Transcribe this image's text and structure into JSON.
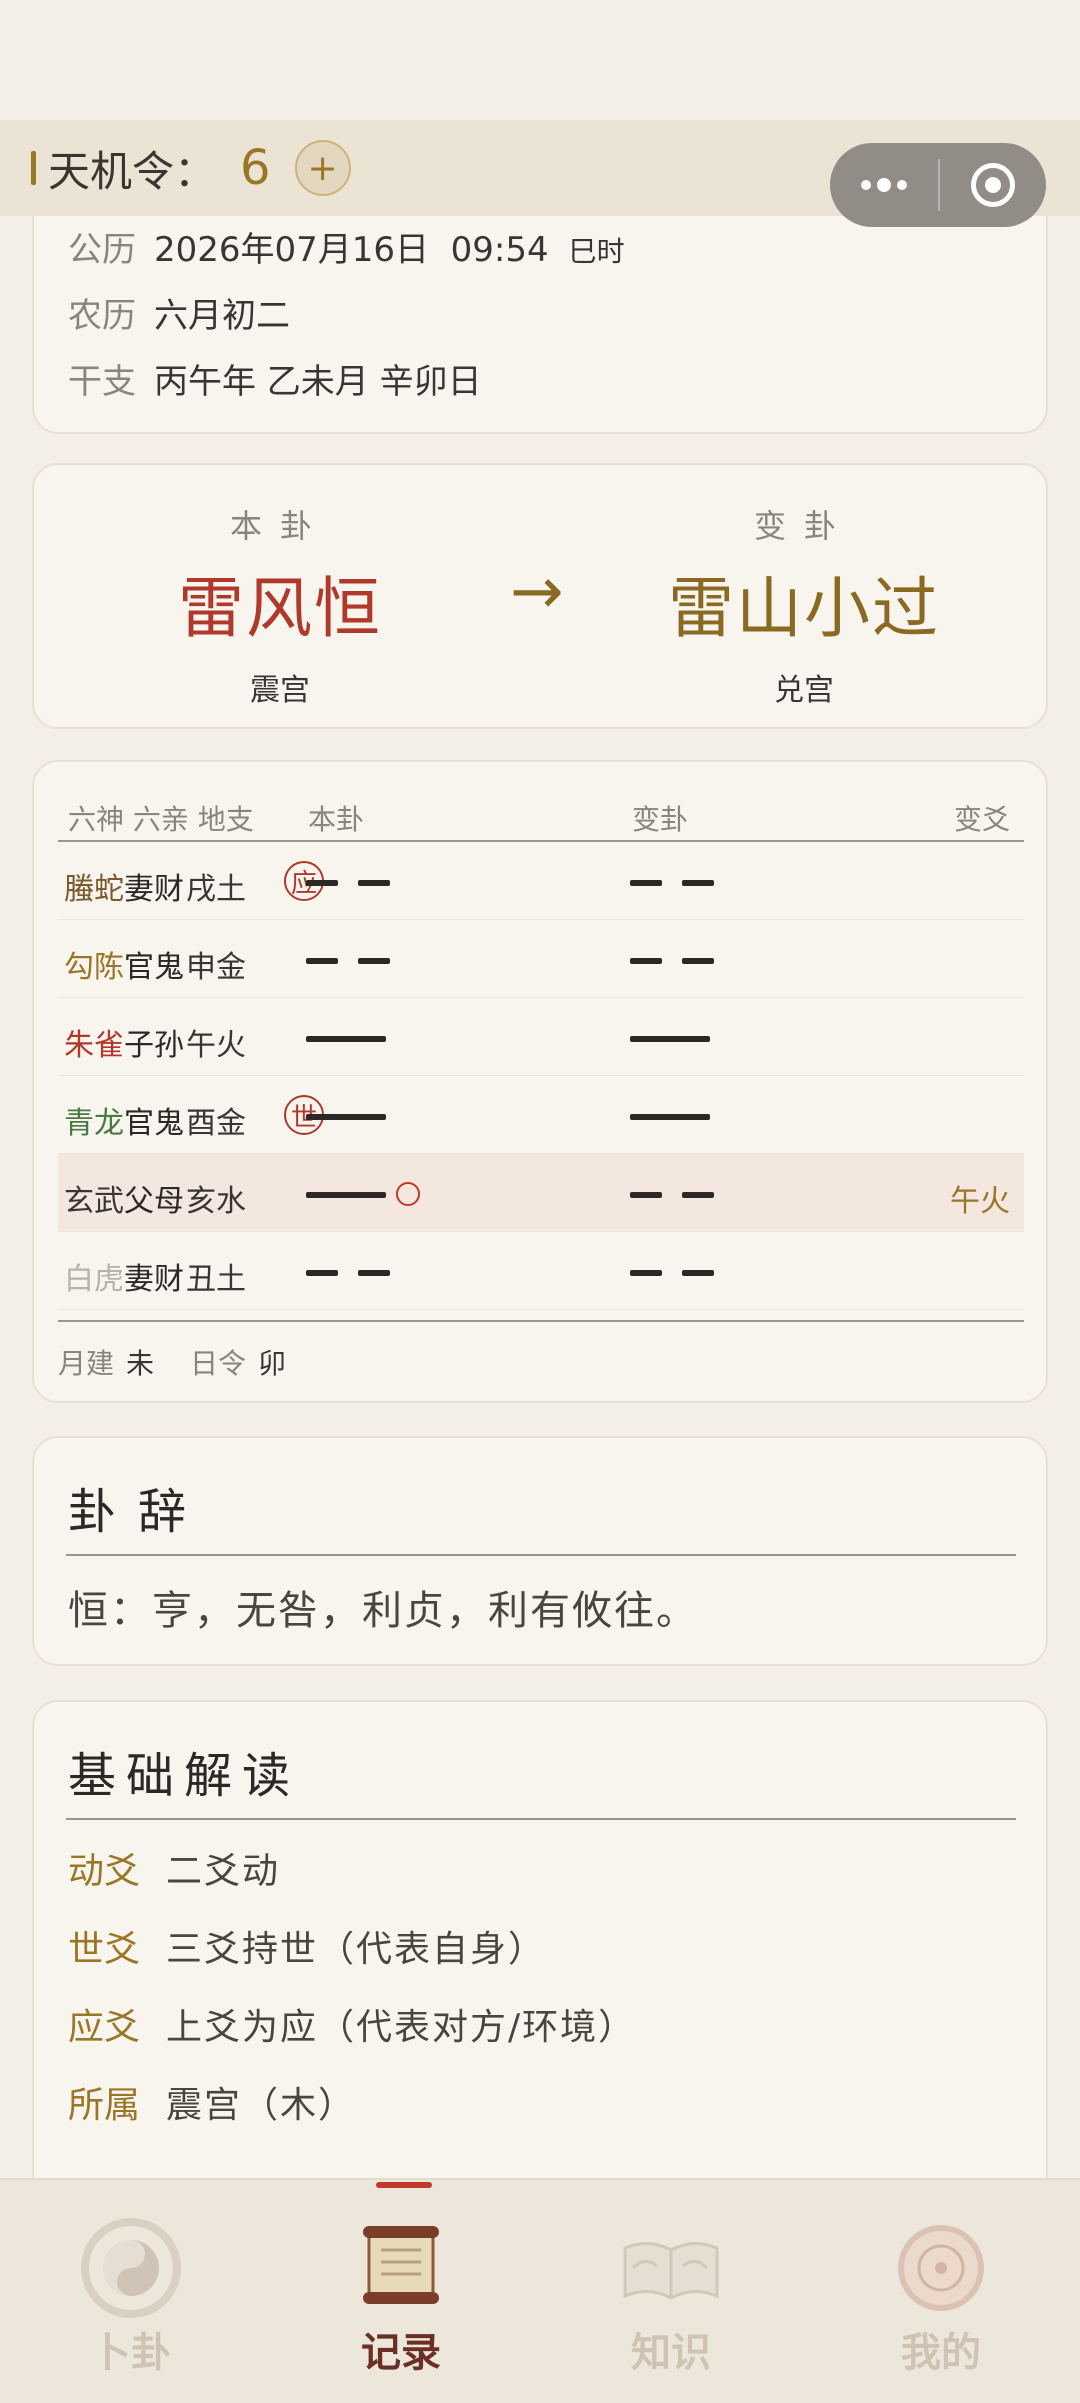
{
  "topbar": {
    "label": "天机令：",
    "count": "6",
    "plus": "+"
  },
  "date": {
    "gregorian_key": "公历",
    "gregorian_val": "2026年07月16日  09:54",
    "gregorian_hour": "巳时",
    "lunar_key": "农历",
    "lunar_val": "六月初二",
    "ganzhi_key": "干支",
    "ganzhi_val": "丙午年 乙未月 辛卯日"
  },
  "gua": {
    "ben_label": "本卦",
    "ben_name": "雷风恒",
    "ben_palace": "震宫",
    "bian_label": "变卦",
    "bian_name": "雷山小过",
    "bian_palace": "兑宫",
    "arrow": "→"
  },
  "table": {
    "headers": {
      "spirits": "六神 六亲  地支",
      "ben": "本卦",
      "bian": "变卦",
      "change": "变爻"
    },
    "rows": [
      {
        "spirit": "螣蛇",
        "relation": "妻财",
        "branch": "戌土",
        "mark": "应",
        "ben": "yin",
        "bian": "yin",
        "change": "",
        "spirit_color": "#7d5a2c"
      },
      {
        "spirit": "勾陈",
        "relation": "官鬼",
        "branch": "申金",
        "mark": "",
        "ben": "yin",
        "bian": "yin",
        "change": "",
        "spirit_color": "#9a7626"
      },
      {
        "spirit": "朱雀",
        "relation": "子孙",
        "branch": "午火",
        "mark": "",
        "ben": "yang",
        "bian": "yang",
        "change": "",
        "spirit_color": "#b0392c"
      },
      {
        "spirit": "青龙",
        "relation": "官鬼",
        "branch": "酉金",
        "mark": "世",
        "ben": "yang",
        "bian": "yang",
        "change": "",
        "spirit_color": "#4a7a44"
      },
      {
        "spirit": "玄武",
        "relation": "父母",
        "branch": "亥水",
        "mark": "",
        "ben": "yang",
        "bian": "yin",
        "change": "午火",
        "moving": true,
        "spirit_color": "#3a3530"
      },
      {
        "spirit": "白虎",
        "relation": "妻财",
        "branch": "丑土",
        "mark": "",
        "ben": "yin",
        "bian": "yin",
        "change": "",
        "spirit_color": "#b9b2a8"
      }
    ],
    "month_key": "月建",
    "month_val": "未",
    "day_key": "日令",
    "day_val": "卯"
  },
  "guaci": {
    "title": "卦辞",
    "text": "恒：亨，无咎，利贞，利有攸往。"
  },
  "basic": {
    "title": "基础解读",
    "items": [
      {
        "key": "动爻",
        "val": "二爻动"
      },
      {
        "key": "世爻",
        "val": "三爻持世（代表自身）"
      },
      {
        "key": "应爻",
        "val": "上爻为应（代表对方/环境）"
      },
      {
        "key": "所属",
        "val": "震宫（木）"
      }
    ]
  },
  "nav": [
    {
      "label": "卜卦",
      "icon": "bagua-icon"
    },
    {
      "label": "记录",
      "icon": "scroll-icon",
      "active": true
    },
    {
      "label": "知识",
      "icon": "book-icon"
    },
    {
      "label": "我的",
      "icon": "compass-icon"
    }
  ]
}
